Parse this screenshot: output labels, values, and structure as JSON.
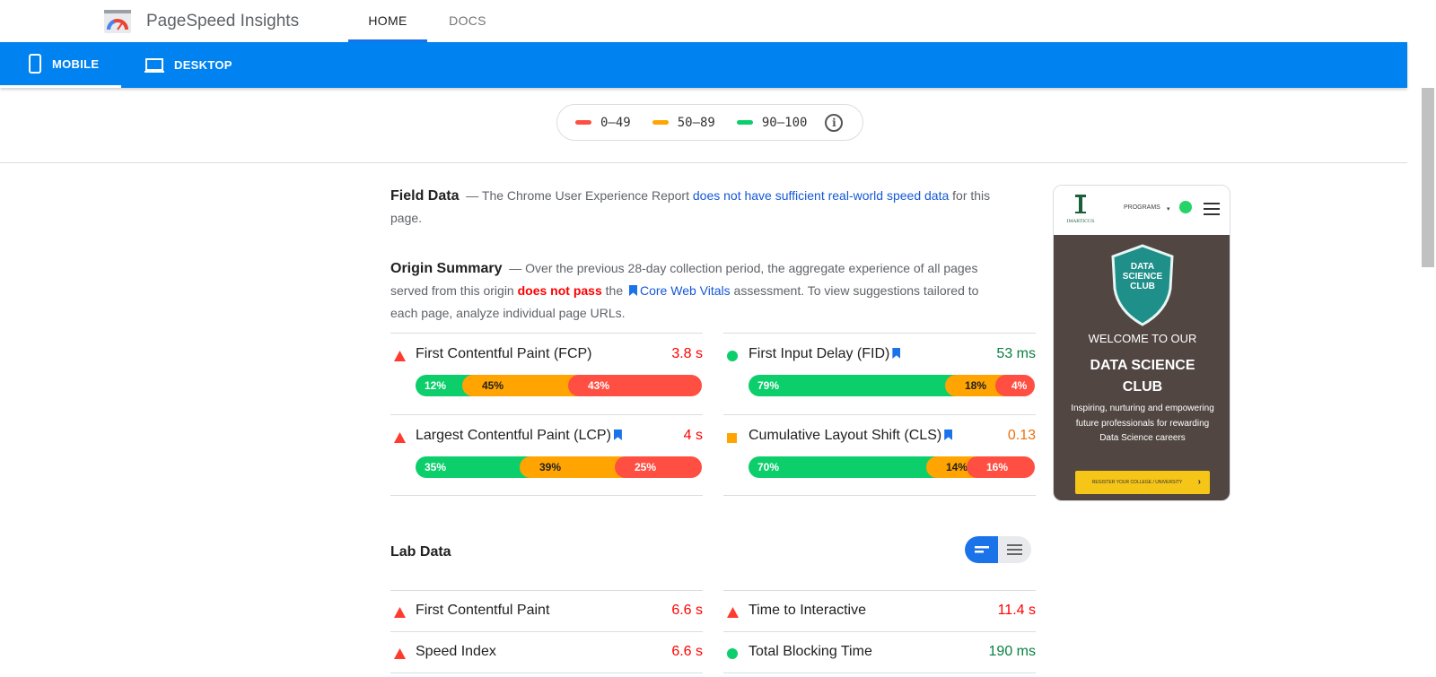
{
  "header": {
    "brand": "PageSpeed Insights",
    "tabs": [
      {
        "label": "HOME",
        "active": true
      },
      {
        "label": "DOCS",
        "active": false
      }
    ]
  },
  "device_tabs": [
    {
      "label": "MOBILE",
      "icon": "phone-icon",
      "active": true
    },
    {
      "label": "DESKTOP",
      "icon": "laptop-icon",
      "active": false
    }
  ],
  "legend": {
    "items": [
      {
        "label": "0–49",
        "color": "#ff4e42"
      },
      {
        "label": "50–89",
        "color": "#ffa400"
      },
      {
        "label": "90–100",
        "color": "#0cce6b"
      }
    ]
  },
  "field_data": {
    "title": "Field Data",
    "text_before": "— The Chrome User Experience Report ",
    "link": "does not have sufficient real-world speed data",
    "text_after": " for this page."
  },
  "origin_summary": {
    "title": "Origin Summary",
    "text1": "— Over the previous 28-day collection period, the aggregate experience of all pages served from this origin ",
    "bad": "does not pass",
    "text2": " the ",
    "link": "Core Web Vitals",
    "text3": " assessment. To view suggestions tailored to each page, analyze individual page URLs.",
    "metrics": [
      {
        "name": "First Contentful Paint (FCP)",
        "value": "3.8 s",
        "status": "slow",
        "bookmark": false,
        "dist": [
          "12%",
          "45%",
          "43%"
        ]
      },
      {
        "name": "First Input Delay (FID)",
        "value": "53 ms",
        "status": "fast",
        "bookmark": true,
        "dist": [
          "79%",
          "18%",
          "4%"
        ]
      },
      {
        "name": "Largest Contentful Paint (LCP)",
        "value": "4 s",
        "status": "slow",
        "bookmark": true,
        "dist": [
          "35%",
          "39%",
          "25%"
        ]
      },
      {
        "name": "Cumulative Layout Shift (CLS)",
        "value": "0.13",
        "status": "average",
        "bookmark": true,
        "dist": [
          "70%",
          "14%",
          "16%"
        ]
      }
    ]
  },
  "lab_data": {
    "title": "Lab Data",
    "metrics": [
      {
        "name": "First Contentful Paint",
        "value": "6.6 s",
        "status": "slow"
      },
      {
        "name": "Time to Interactive",
        "value": "11.4 s",
        "status": "slow"
      },
      {
        "name": "Speed Index",
        "value": "6.6 s",
        "status": "slow"
      },
      {
        "name": "Total Blocking Time",
        "value": "190 ms",
        "status": "fast"
      }
    ]
  },
  "screenshot": {
    "logo_text": "IMARTICUS",
    "menu_label": "PROGRAMS",
    "badge_text": "DATA SCIENCE CLUB",
    "welcome": "WELCOME TO OUR",
    "heading": "DATA SCIENCE CLUB",
    "body": "Inspiring, nurturing and empowering future professionals for rewarding Data Science careers",
    "cta": "REGISTER YOUR COLLEGE / UNIVERSITY"
  }
}
